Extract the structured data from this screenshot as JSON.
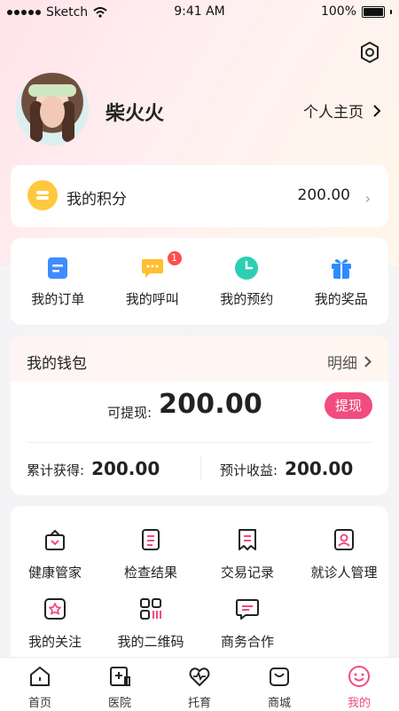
{
  "status_bar": {
    "carrier": "Sketch",
    "time": "9:41 AM",
    "battery": "100%"
  },
  "profile": {
    "name": "柴火火",
    "homepage_link": "个人主页"
  },
  "points": {
    "label": "我的积分",
    "value": "200.00"
  },
  "shortcuts": [
    {
      "label": "我的订单",
      "icon": "order-icon",
      "color": "#3f8cff"
    },
    {
      "label": "我的呼叫",
      "icon": "chat-icon",
      "color": "#ffbf2f",
      "badge": "1"
    },
    {
      "label": "我的预约",
      "icon": "clock-icon",
      "color": "#2ccfb2"
    },
    {
      "label": "我的奖品",
      "icon": "gift-icon",
      "color": "#2e8cff"
    }
  ],
  "wallet": {
    "title": "我的钱包",
    "detail": "明细",
    "withdrawable_label": "可提现:",
    "withdrawable_value": "200.00",
    "withdraw_button": "提现",
    "total_label": "累计获得:",
    "total_value": "200.00",
    "estimated_label": "预计收益:",
    "estimated_value": "200.00"
  },
  "services": [
    {
      "label": "健康管家",
      "icon": "health-manager-icon"
    },
    {
      "label": "检查结果",
      "icon": "report-icon"
    },
    {
      "label": "交易记录",
      "icon": "transaction-icon"
    },
    {
      "label": "就诊人管理",
      "icon": "patient-icon"
    },
    {
      "label": "我的关注",
      "icon": "follow-icon"
    },
    {
      "label": "我的二维码",
      "icon": "qrcode-icon"
    },
    {
      "label": "商务合作",
      "icon": "cooperation-icon"
    }
  ],
  "tabbar": [
    {
      "label": "首页",
      "icon": "home-icon"
    },
    {
      "label": "医院",
      "icon": "hospital-icon"
    },
    {
      "label": "托育",
      "icon": "heart-pulse-icon"
    },
    {
      "label": "商城",
      "icon": "shop-icon"
    },
    {
      "label": "我的",
      "icon": "smile-icon",
      "active": true
    }
  ],
  "colors": {
    "accent": "#f14b7f",
    "coin": "#ffc83d"
  }
}
